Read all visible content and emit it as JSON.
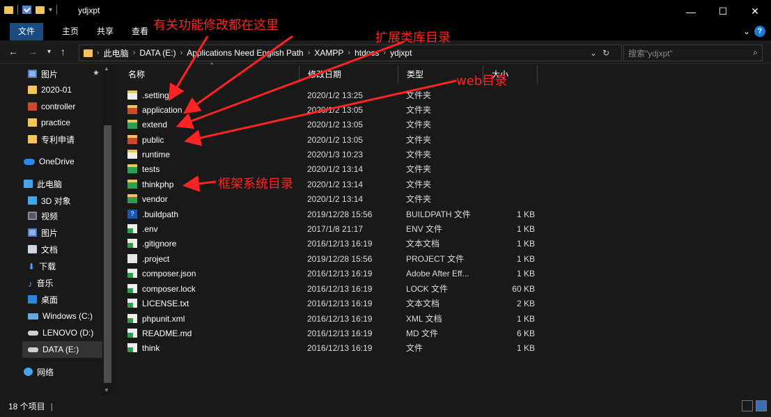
{
  "window": {
    "title": "ydjxpt",
    "controls": [
      "—",
      "☐",
      "✕"
    ]
  },
  "ribbon": {
    "tabs": [
      "文件",
      "主页",
      "共享",
      "查看"
    ]
  },
  "address": {
    "segments": [
      "此电脑",
      "DATA (E:)",
      "Applications Need English Path",
      "XAMPP",
      "htdocs",
      "ydjxpt"
    ],
    "search_placeholder": "搜索\"ydjxpt\""
  },
  "nav_pane": {
    "items": [
      {
        "label": "图片",
        "icon": "picture-icon"
      },
      {
        "label": "2020-01",
        "icon": "folder-icon"
      },
      {
        "label": "controller",
        "icon": "folder-icon"
      },
      {
        "label": "practice",
        "icon": "folder-icon"
      },
      {
        "label": "专利申请",
        "icon": "folder-icon"
      },
      {
        "label": "OneDrive",
        "icon": "cloud-icon"
      },
      {
        "label": "此电脑",
        "icon": "computer-icon"
      },
      {
        "label": "3D 对象",
        "icon": "3d-objects-icon"
      },
      {
        "label": "视频",
        "icon": "video-icon"
      },
      {
        "label": "图片",
        "icon": "picture-icon"
      },
      {
        "label": "文档",
        "icon": "document-icon"
      },
      {
        "label": "下载",
        "icon": "download-icon"
      },
      {
        "label": "音乐",
        "icon": "music-icon"
      },
      {
        "label": "桌面",
        "icon": "desktop-icon"
      },
      {
        "label": "Windows (C:)",
        "icon": "drive-icon"
      },
      {
        "label": "LENOVO (D:)",
        "icon": "drive-icon"
      },
      {
        "label": "DATA (E:)",
        "icon": "drive-icon",
        "selected": true
      },
      {
        "label": "网络",
        "icon": "network-icon"
      }
    ]
  },
  "columns": {
    "name": "名称",
    "date": "修改日期",
    "type": "类型",
    "size": "大小"
  },
  "files": [
    {
      "name": ".settings",
      "date": "2020/1/2 13:25",
      "type": "文件夹",
      "size": ""
    },
    {
      "name": "application",
      "date": "2020/1/2 13:05",
      "type": "文件夹",
      "size": ""
    },
    {
      "name": "extend",
      "date": "2020/1/2 13:05",
      "type": "文件夹",
      "size": ""
    },
    {
      "name": "public",
      "date": "2020/1/2 13:05",
      "type": "文件夹",
      "size": ""
    },
    {
      "name": "runtime",
      "date": "2020/1/3 10:23",
      "type": "文件夹",
      "size": ""
    },
    {
      "name": "tests",
      "date": "2020/1/2 13:14",
      "type": "文件夹",
      "size": ""
    },
    {
      "name": "thinkphp",
      "date": "2020/1/2 13:14",
      "type": "文件夹",
      "size": ""
    },
    {
      "name": "vendor",
      "date": "2020/1/2 13:14",
      "type": "文件夹",
      "size": ""
    },
    {
      "name": ".buildpath",
      "date": "2019/12/28 15:56",
      "type": "BUILDPATH 文件",
      "size": "1 KB"
    },
    {
      "name": ".env",
      "date": "2017/1/8 21:17",
      "type": "ENV 文件",
      "size": "1 KB"
    },
    {
      "name": ".gitignore",
      "date": "2016/12/13 16:19",
      "type": "文本文档",
      "size": "1 KB"
    },
    {
      "name": ".project",
      "date": "2019/12/28 15:56",
      "type": "PROJECT 文件",
      "size": "1 KB"
    },
    {
      "name": "composer.json",
      "date": "2016/12/13 16:19",
      "type": "Adobe After Eff...",
      "size": "1 KB"
    },
    {
      "name": "composer.lock",
      "date": "2016/12/13 16:19",
      "type": "LOCK 文件",
      "size": "60 KB"
    },
    {
      "name": "LICENSE.txt",
      "date": "2016/12/13 16:19",
      "type": "文本文档",
      "size": "2 KB"
    },
    {
      "name": "phpunit.xml",
      "date": "2016/12/13 16:19",
      "type": "XML 文档",
      "size": "1 KB"
    },
    {
      "name": "README.md",
      "date": "2016/12/13 16:19",
      "type": "MD 文件",
      "size": "6 KB"
    },
    {
      "name": "think",
      "date": "2016/12/13 16:19",
      "type": "文件",
      "size": "1 KB"
    }
  ],
  "status": {
    "count": "18 个项目"
  },
  "annotations": {
    "modify": "有关功能修改都在这里",
    "extend": "扩展类库目录",
    "web": "web目录",
    "framework": "框架系统目录",
    "color": "#ff2323"
  }
}
